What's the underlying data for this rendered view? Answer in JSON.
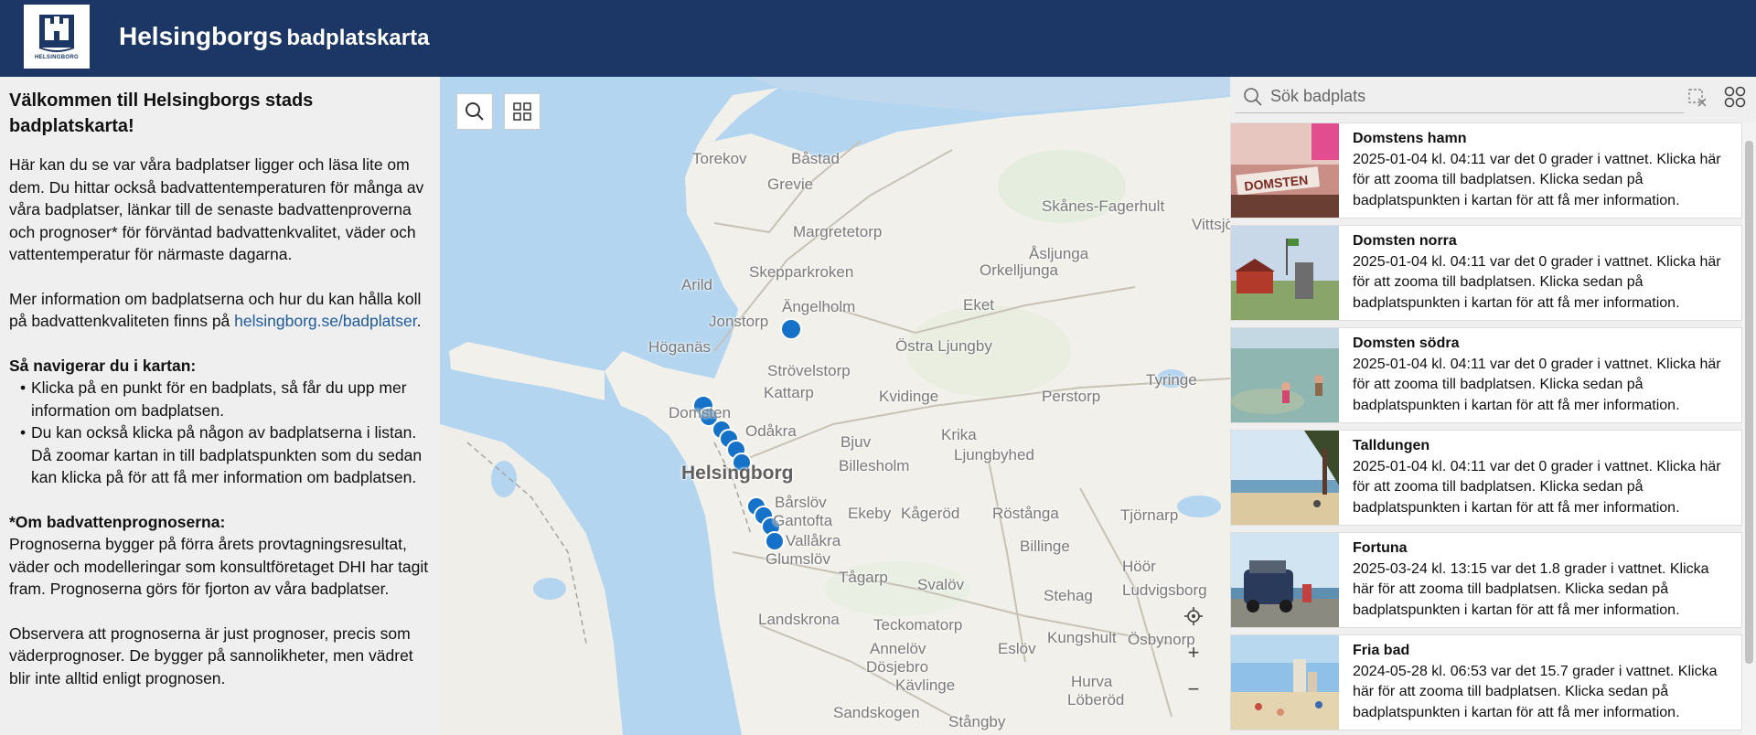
{
  "header": {
    "title_main": "Helsingborgs",
    "title_sub": "badplatskarta",
    "logo_text": "HELSINGBORG"
  },
  "intro": {
    "heading": "Välkommen till Helsingborgs stads badplatskarta!",
    "p1": "Här kan du se var våra badplatser ligger och läsa lite om dem. Du hittar också badvattentemperaturen för många av våra badplatser, länkar till de senaste badvattenproverna och prognoser* för förväntad badvattenkvalitet, väder och vattentemperatur för närmaste dagarna.",
    "p2_text": "Mer information om badplatserna och hur du kan hålla koll på badvattenkvaliteten finns på ",
    "p2_link": "helsingborg.se/badplatser",
    "p2_end": ".",
    "nav_heading": "Så navigerar du i kartan:",
    "nav_items": [
      "Klicka på en punkt för en badplats, så får du upp mer information om badplatsen.",
      "Du kan också klicka på någon av badplatserna i listan. Då zoomar kartan in till badplatspunkten som du sedan kan klicka på för att få mer information om badplatsen."
    ],
    "prog_heading": "*Om badvattenprognoserna:",
    "prog_p1": "Prognoserna bygger på förra årets provtagningsresultat, väder och modelleringar som konsultföretaget DHI har tagit fram. Prognoserna görs för fjorton av våra badplatser.",
    "prog_p2": "Observera att prognoserna är just prognoser, precis som väderprognoser. De bygger på sannolikheter, men vädret blir inte alltid enligt prognosen."
  },
  "map": {
    "labels": {
      "torekov": "Torekov",
      "bastad": "Båstad",
      "grevie": "Grevie",
      "skanes_fagerhult": "Skånes-Fagerhult",
      "vittsjo": "Vittsjö",
      "margretetorp": "Margretetorp",
      "asljunga": "Åsljunga",
      "arild": "Arild",
      "skepparkroken": "Skepparkroken",
      "orkelljunga": "Orkelljunga",
      "angelholm": "Ängelholm",
      "eket": "Eket",
      "jonstorp": "Jonstorp",
      "hoganas": "Höganäs",
      "ostra_ljungby": "Östra Ljungby",
      "strovelstorp": "Strövelstorp",
      "tyringe": "Tyringe",
      "kattarp": "Kattarp",
      "kvidinge": "Kvidinge",
      "perstorp": "Perstorp",
      "domsten": "Domsten",
      "odakra": "Odåkra",
      "bjuv": "Bjuv",
      "krika": "Krika",
      "ljungbyhed": "Ljungbyhed",
      "billesholm": "Billesholm",
      "helsingborg": "Helsingborg",
      "barslov": "Bårslöv",
      "ekeby": "Ekeby",
      "kagerod": "Kågeröd",
      "rostanga": "Röstånga",
      "tjornarp": "Tjörnarp",
      "gantofta": "Gantofta",
      "vallakra": "Vallåkra",
      "glumslov": "Glumslöv",
      "billinge": "Billinge",
      "hoor": "Höör",
      "ludvigsborg": "Ludvigsborg",
      "tagarp": "Tågarp",
      "svalov": "Svalöv",
      "stehag": "Stehag",
      "landskrona": "Landskrona",
      "teckomatorp": "Teckomatorp",
      "kungshult": "Kungshult",
      "annelov": "Annelöv",
      "eslov": "Eslöv",
      "osbynorp": "Ösbynorp",
      "dosjebro": "Dösjebro",
      "kavlinge": "Kävlinge",
      "hurva": "Hurva",
      "loberod": "Löberöd",
      "sandskogen": "Sandskogen",
      "stangby": "Stångby"
    },
    "zoom_in": "+",
    "zoom_out": "−"
  },
  "sidebar": {
    "search_placeholder": "Sök badplats",
    "beaches": [
      {
        "name": "Domstens hamn",
        "desc": "2025-01-04 kl. 04:11 var det 0  grader i vattnet. Klicka här för att zooma till badplatsen. Klicka sedan på badplatspunkten i kartan för att få mer information."
      },
      {
        "name": "Domsten norra",
        "desc": "2025-01-04 kl. 04:11 var det 0  grader i vattnet. Klicka här för att zooma till badplatsen. Klicka sedan på badplatspunkten i kartan för att få mer information."
      },
      {
        "name": "Domsten södra",
        "desc": "2025-01-04 kl. 04:11 var det 0  grader i vattnet. Klicka här för att zooma till badplatsen. Klicka sedan på badplatspunkten i kartan för att få mer information."
      },
      {
        "name": "Talldungen",
        "desc": "2025-01-04 kl. 04:11 var det 0  grader i vattnet. Klicka här för att zooma till badplatsen. Klicka sedan på badplatspunkten i kartan för att få mer information."
      },
      {
        "name": "Fortuna",
        "desc": "2025-03-24 kl. 13:15 var det 1.8  grader i vattnet. Klicka här för att zooma till badplatsen. Klicka sedan på badplatspunkten i kartan för att få mer information."
      },
      {
        "name": "Fria bad",
        "desc": "2024-05-28 kl. 06:53 var det 15.7  grader i vattnet. Klicka här för att zooma till badplatsen. Klicka sedan på badplatspunkten i kartan för att få mer information."
      }
    ]
  },
  "colors": {
    "header": "#1c3765",
    "water": "#b3d5f0",
    "land": "#f2f0ea",
    "marker": "#1572c8",
    "link": "#1e5a9e"
  }
}
